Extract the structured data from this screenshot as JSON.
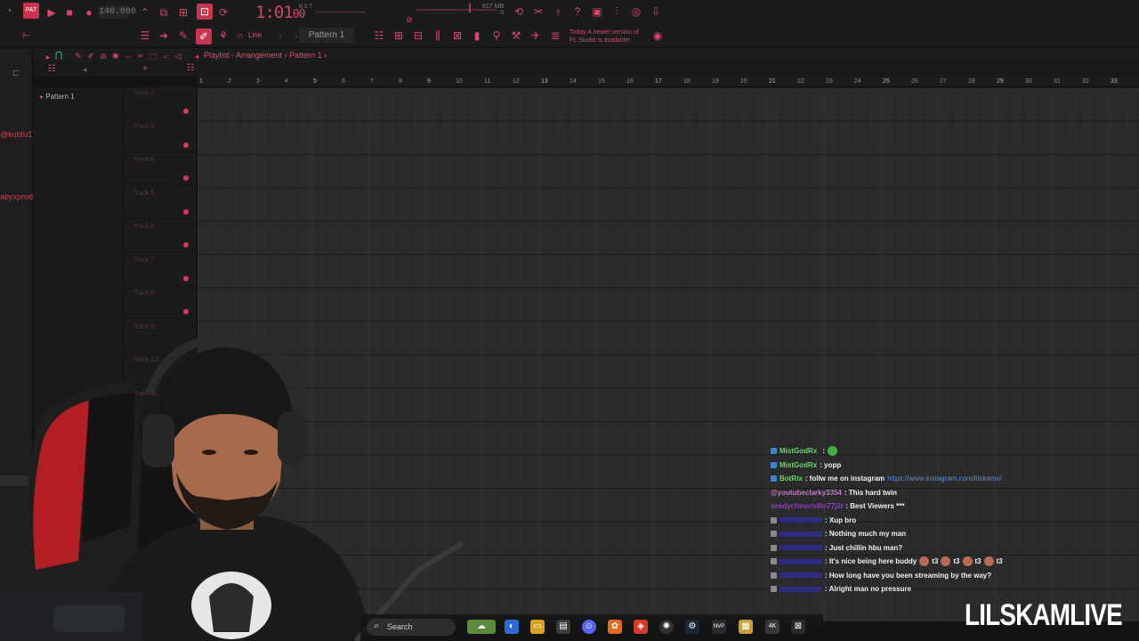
{
  "toolbar": {
    "tempo": "140.000",
    "time": "1:01",
    "time_ms": "00",
    "time_label": "B:S:T",
    "memory": "817 MB",
    "memory_sub": "0",
    "snap_mode": "Line",
    "pattern_selector": "Pattern 1",
    "news_line1": "Today  A newer version of",
    "news_line2": "FL Studio is available!"
  },
  "left_panel": {
    "text1": "@kubfu1]",
    "text2": "abyxprod"
  },
  "playlist": {
    "breadcrumb": "Playlist - Arrangement",
    "breadcrumb_sep": "›",
    "breadcrumb_pattern": "Pattern 1",
    "pattern_list": [
      "Pattern 1"
    ],
    "bar_numbers": [
      "1",
      "2",
      "3",
      "4",
      "5",
      "6",
      "7",
      "8",
      "9",
      "10",
      "11",
      "12",
      "13",
      "14",
      "15",
      "16",
      "17",
      "18",
      "19",
      "20",
      "21",
      "22",
      "23",
      "24",
      "25",
      "26",
      "27",
      "28",
      "29",
      "30",
      "31",
      "32",
      "33"
    ],
    "tracks": [
      "Track 2",
      "Track 3",
      "Track 4",
      "Track 5",
      "Track 6",
      "Track 7",
      "Track 8",
      "Track 9",
      "Track 10",
      "Track 11"
    ]
  },
  "chat": [
    {
      "user": "MistGodRx",
      "message": "",
      "emote": true,
      "user_color": "#6cd46c"
    },
    {
      "user": "MistGodRx",
      "message": ": yopp",
      "user_color": "#6cd46c"
    },
    {
      "user": "BotRix",
      "message": ": follw me on instagram",
      "link": "https://www.instagram.com/lilskamx/",
      "user_color": "#6cd46c"
    },
    {
      "user": "@youtubeclarky3354",
      "message": ": This hard twin",
      "user_color": "#c07cc4"
    },
    {
      "user": "seedychmerx4fo77j2t",
      "message": ": Best Viewers ***",
      "user_color": "#8a3fbf"
    },
    {
      "user": "",
      "message": ": Xup bro",
      "user_color": "#3a3adb"
    },
    {
      "user": "",
      "message": ": Nothing much my man",
      "user_color": "#3a3adb"
    },
    {
      "user": "",
      "message": ": Just chillin hbu man?",
      "user_color": "#3a3adb"
    },
    {
      "user": "",
      "message": ": It's nice being here buddy",
      "emotes": "t3 t3 t3 t3",
      "user_color": "#3a3adb"
    },
    {
      "user": "",
      "message": ": How long have you been streaming by the way?",
      "user_color": "#3a3adb"
    },
    {
      "user": "",
      "message": ": Alright man no pressure",
      "user_color": "#3a3adb"
    }
  ],
  "taskbar": {
    "search_placeholder": "Search"
  },
  "watermark": "LILSKAMLIVE",
  "colors": {
    "accent": "#e0446a",
    "grid_bg": "#2b2b2b",
    "panel_bg": "#1b1b1b"
  }
}
